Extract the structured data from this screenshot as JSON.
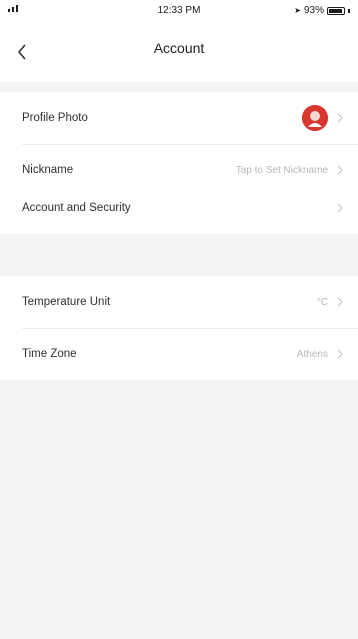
{
  "status_bar": {
    "time": "12:33 PM",
    "battery": "93%"
  },
  "nav": {
    "title": "Account"
  },
  "rows": {
    "profile_photo": {
      "label": "Profile Photo"
    },
    "nickname": {
      "label": "Nickname",
      "value": "Tap to Set Nickname"
    },
    "account_security": {
      "label": "Account and Security"
    },
    "temperature_unit": {
      "label": "Temperature Unit",
      "value": "°C"
    },
    "time_zone": {
      "label": "Time Zone",
      "value": "Athens"
    }
  },
  "icons": {
    "back": "chevron-left-icon",
    "row_arrow": "chevron-right-icon",
    "avatar": "avatar-icon"
  },
  "colors": {
    "background": "#f4f4f6",
    "surface": "#ffffff",
    "avatar": "#d9362f"
  }
}
